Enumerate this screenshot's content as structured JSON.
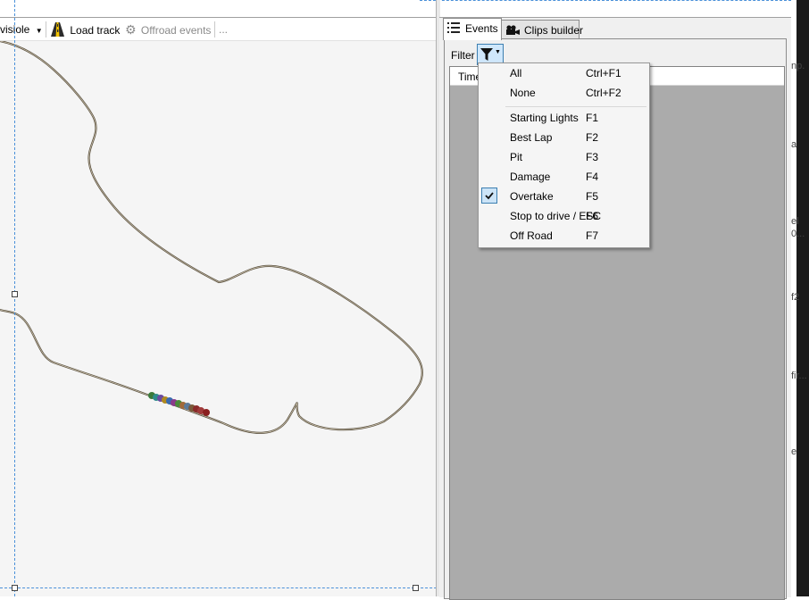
{
  "toolbar": {
    "view_label": "visiole",
    "load_track": "Load track",
    "offroad_events": "Offroad events",
    "more": "..."
  },
  "tabs": [
    {
      "label": "Events",
      "icon": "list-icon",
      "active": true
    },
    {
      "label": "Clips builder",
      "icon": "camera-icon",
      "active": false
    }
  ],
  "filter": {
    "label": "Filter",
    "icon": "funnel-icon"
  },
  "grid": {
    "column_time": "Time"
  },
  "menu": {
    "items": [
      {
        "label": "All",
        "shortcut": "Ctrl+F1",
        "checked": false
      },
      {
        "label": "None",
        "shortcut": "Ctrl+F2",
        "checked": false
      },
      {
        "label": "Starting Lights",
        "shortcut": "F1",
        "checked": false
      },
      {
        "label": "Best Lap",
        "shortcut": "F2",
        "checked": false
      },
      {
        "label": "Pit",
        "shortcut": "F3",
        "checked": false
      },
      {
        "label": "Damage",
        "shortcut": "F4",
        "checked": false
      },
      {
        "label": "Overtake",
        "shortcut": "F5",
        "checked": true
      },
      {
        "label": "Stop to drive / ESC",
        "shortcut": "F6",
        "checked": false
      },
      {
        "label": "Off Road",
        "shortcut": "F7",
        "checked": false
      }
    ]
  },
  "edge_fragments": [
    "np.",
    "a",
    "el",
    "0...",
    "f2",
    "fir...",
    "e"
  ],
  "colors": {
    "track": "#5b5140",
    "grid_bg": "#ababab",
    "selection": "#cce4f7",
    "guide": "#4a90d9"
  }
}
